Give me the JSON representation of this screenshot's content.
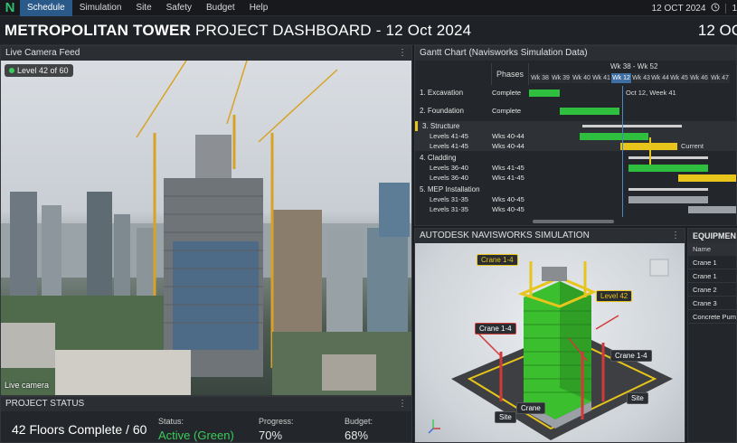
{
  "menu": {
    "items": [
      "Schedule",
      "Simulation",
      "Site",
      "Safety",
      "Budget",
      "Help"
    ],
    "active": "Schedule",
    "date": "12 OCT 2024",
    "clock_icon": "clock-icon",
    "time_fragment": "1"
  },
  "logo": "N",
  "title": {
    "bold": "METROPOLITAN TOWER",
    "rest": " PROJECT DASHBOARD - 12 Oct 2024",
    "right": "12 OC"
  },
  "camera": {
    "header": "Live Camera Feed",
    "badge": "Level 42 of 60",
    "caption": "Live camera"
  },
  "status": {
    "header": "PROJECT STATUS",
    "floors": "42 Floors Complete / 60",
    "status_label": "Status:",
    "status_value": "Active (Green)",
    "progress_label": "Progress:",
    "progress_value": "70%",
    "budget_label": "Budget:",
    "budget_value": "68%"
  },
  "gantt": {
    "header": "Gantt Chart (Navisworks Simulation Data)",
    "phases_header": "Phases",
    "range": "Wk 38 - Wk 52",
    "weeks": [
      "Wk 38",
      "Wk 39",
      "Wk 40",
      "Wk 41",
      "Wk 12",
      "Wk 43",
      "Wk 44",
      "Wk 45",
      "Wk 46",
      "Wk 47"
    ],
    "current_week": "Wk 12",
    "current_note": "Oct 12, Week 41",
    "current_label": "Current",
    "rows": [
      {
        "name": "1. Excavation",
        "phase": "Complete"
      },
      {
        "name": "2. Foundation",
        "phase": "Complete"
      },
      {
        "name": "3. Structure",
        "phase": ""
      },
      {
        "name": "Levels 41-45",
        "phase": "Wks 40-44"
      },
      {
        "name": "Levels 41-45",
        "phase": "Wks 40-44"
      },
      {
        "name": "4. Cladding",
        "phase": ""
      },
      {
        "name": "Levels 36-40",
        "phase": "Wks 41-45"
      },
      {
        "name": "Levels 36-40",
        "phase": "Wks 41-45"
      },
      {
        "name": "5. MEP Installation",
        "phase": ""
      },
      {
        "name": "Levels 31-35",
        "phase": "Wks 40-45"
      },
      {
        "name": "Levels 31-35",
        "phase": "Wks 40-45"
      }
    ],
    "colors": {
      "green": "#2fbf3f",
      "yellow": "#e8c51a",
      "gray": "#9aa0a6"
    }
  },
  "simulation": {
    "header": "AUTODESK NAVISWORKS SIMULATION",
    "tags": [
      "Crane 1-4",
      "Level 42",
      "Crane 1-4",
      "Crane 1-4",
      "Crane",
      "Site",
      "Site"
    ]
  },
  "equipment": {
    "header": "EQUIPMENT",
    "column": "Name",
    "rows": [
      "Crane 1",
      "Crane 1",
      "Crane 2",
      "Crane 3",
      "Concrete Pump"
    ]
  }
}
